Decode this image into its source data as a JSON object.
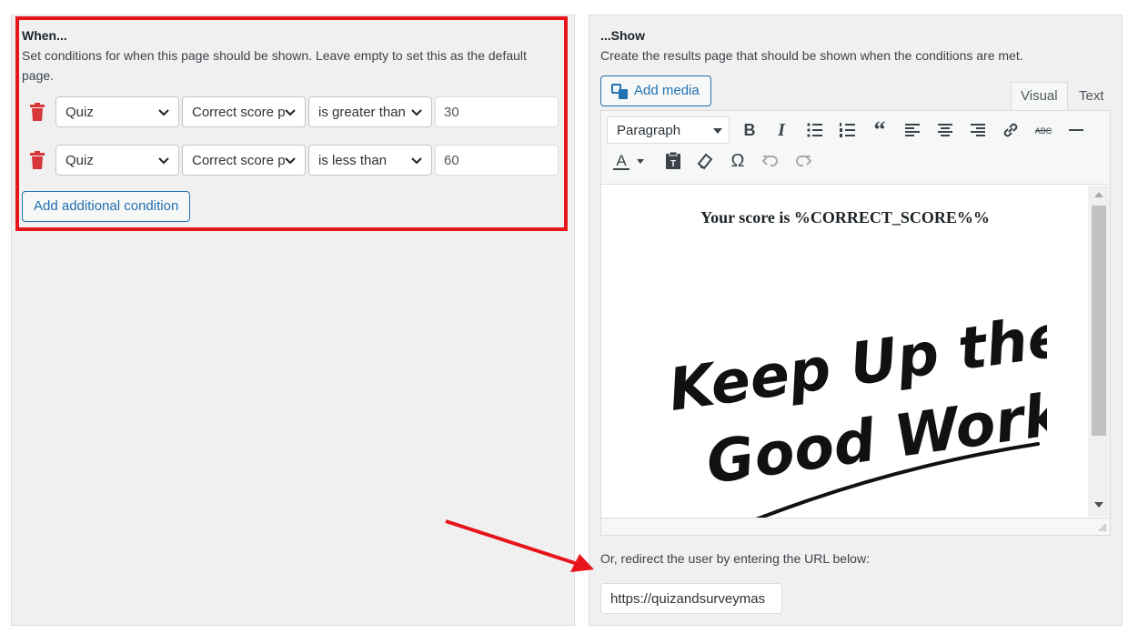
{
  "when": {
    "title": "When...",
    "description": "Set conditions for when this page should be shown. Leave empty to set this as the default page.",
    "conditions": [
      {
        "source": "Quiz",
        "field": "Correct score p",
        "operator": "is greater than",
        "value": "30"
      },
      {
        "source": "Quiz",
        "field": "Correct score p",
        "operator": "is less than",
        "value": "60"
      }
    ],
    "add_condition_label": "Add additional condition"
  },
  "show": {
    "title": "...Show",
    "description": "Create the results page that should be shown when the conditions are met.",
    "add_media_label": "Add media",
    "tabs": {
      "visual": "Visual",
      "text": "Text"
    },
    "format_select": "Paragraph",
    "editor_heading": "Your score is %CORRECT_SCORE%%",
    "image_lines": [
      "Keep Up the",
      "Good Work!"
    ],
    "redirect_label": "Or, redirect the user by entering the URL below:",
    "redirect_url": "https://quizandsurveymas"
  },
  "toolbar_icons": [
    "bold-icon",
    "italic-icon",
    "bullet-list-icon",
    "numbered-list-icon",
    "blockquote-icon",
    "align-left-icon",
    "align-center-icon",
    "align-right-icon",
    "link-icon",
    "strikethrough-icon",
    "horizontal-rule-icon",
    "text-color-icon",
    "paste-text-icon",
    "clear-formatting-icon",
    "special-character-icon",
    "undo-icon",
    "redo-icon"
  ],
  "colors": {
    "accent": "#2271b1",
    "highlight": "#e8141b",
    "trash": "#d63638"
  }
}
